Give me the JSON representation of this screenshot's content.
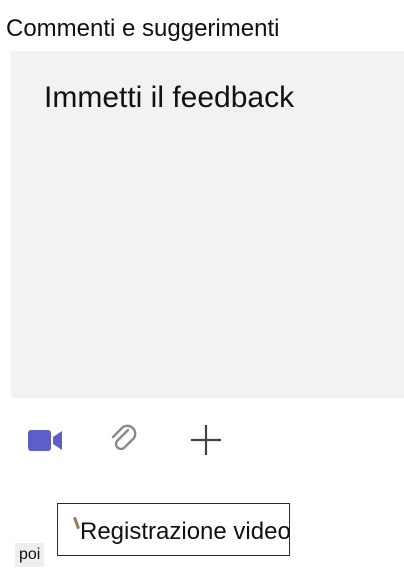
{
  "form": {
    "section_label": "Commenti e suggerimenti",
    "feedback_placeholder": "Immetti il feedback"
  },
  "toolbar": {
    "buttons": [
      {
        "icon": "video-camera-icon",
        "color": "#5b5fc7"
      },
      {
        "icon": "paperclip-icon",
        "color": "#8a8a8a"
      },
      {
        "icon": "plus-icon",
        "color": "#424242"
      }
    ]
  },
  "tooltip": {
    "text": "Registrazione video"
  },
  "chip": {
    "label": "poi"
  },
  "colors": {
    "accent": "#5b5fc7",
    "input_background": "#f2f2f2"
  }
}
